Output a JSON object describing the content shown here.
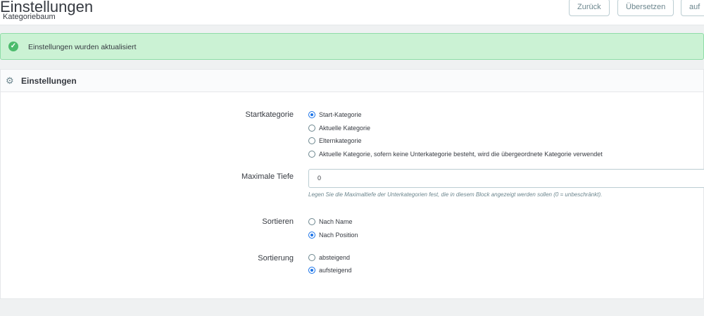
{
  "header": {
    "title": "Einstellungen",
    "subtitle": "Kategoriebaum",
    "buttons": [
      "Zurück",
      "Übersetzen",
      "auf"
    ]
  },
  "alert": {
    "message": "Einstellungen wurden aktualisiert",
    "icon": "check-circle-icon",
    "color": "#cbf2d4"
  },
  "panel": {
    "title": "Einstellungen",
    "icon": "cogs-icon"
  },
  "form": {
    "start": {
      "label": "Startkategorie",
      "options": [
        "Start-Kategorie",
        "Aktuelle Kategorie",
        "Elternkategorie",
        "Aktuelle Kategorie, sofern keine Unterkategorie besteht, wird die übergeordnete Kategorie verwendet"
      ],
      "selected": 0
    },
    "depth": {
      "label": "Maximale Tiefe",
      "value": "0",
      "help": "Legen Sie die Maximaltiefe der Unterkategorien fest, die in diesem Block angezeigt werden sollen (0 = unbeschränkt)."
    },
    "sort": {
      "label": "Sortieren",
      "options": [
        "Nach Name",
        "Nach Position"
      ],
      "selected": 1
    },
    "order": {
      "label": "Sortierung",
      "options": [
        "absteigend",
        "aufsteigend"
      ],
      "selected": 1
    }
  }
}
